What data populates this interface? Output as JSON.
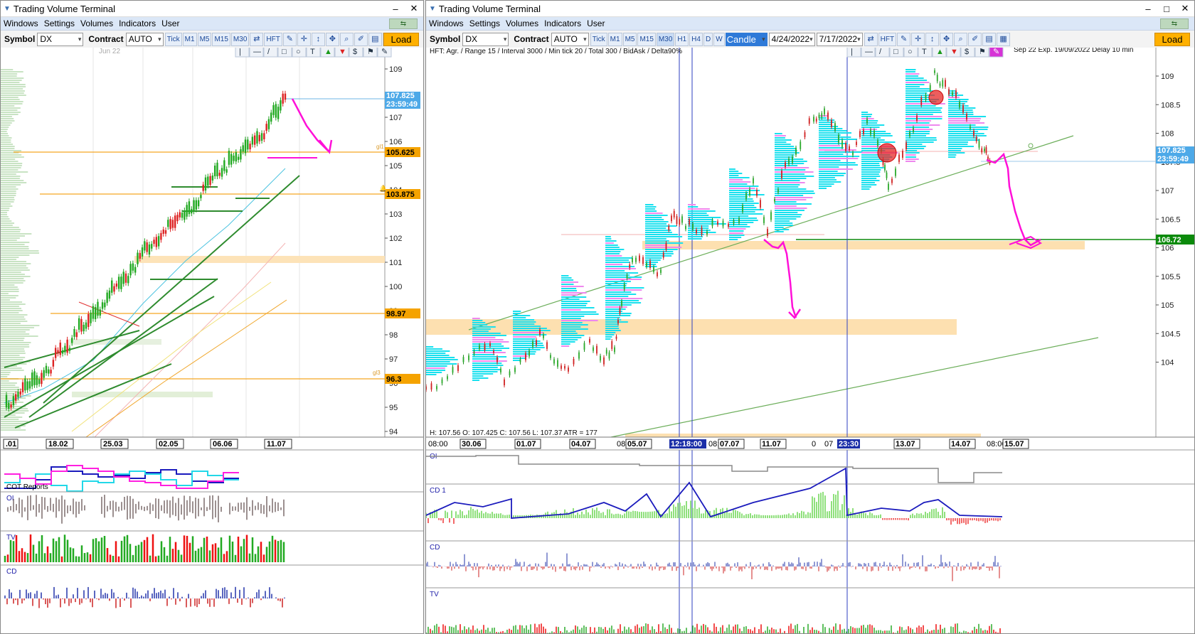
{
  "app": {
    "title": "Trading Volume Terminal"
  },
  "menu": [
    "Windows",
    "Settings",
    "Volumes",
    "Indicators",
    "User"
  ],
  "window_controls": {
    "minimize": "–",
    "maximize": "□",
    "close": "✕"
  },
  "left": {
    "symbol_label": "Symbol",
    "symbol": "DX",
    "contract_label": "Contract",
    "contract": "AUTO",
    "timeframes": [
      "Tick",
      "M1",
      "M5",
      "M15",
      "M30"
    ],
    "hft": "HFT",
    "load": "Load",
    "month_label": "Jun 22",
    "price_ticks": [
      "109",
      "107",
      "106",
      "105",
      "104",
      "103",
      "102",
      "101",
      "100",
      "99",
      "98",
      "97",
      "96",
      "95",
      "94"
    ],
    "price_labels": {
      "last": "107.825",
      "countdown": "23:59:49",
      "l1": "105.625",
      "l2": "103.875",
      "l3": "98.97",
      "l4": "96.3"
    },
    "level_tags": {
      "gl1": "gl1",
      "gl3": "gl3"
    },
    "dates": [
      ".01",
      "18.02",
      "25.03",
      "02.05",
      "06.06",
      "11.07"
    ],
    "panels": {
      "cot": "COT Reports",
      "oi": "OI",
      "tv": "TV",
      "cd": "CD"
    }
  },
  "right": {
    "symbol_label": "Symbol",
    "symbol": "DX",
    "contract_label": "Contract",
    "contract": "AUTO",
    "timeframes": [
      "Tick",
      "M1",
      "M5",
      "M15",
      "M30",
      "H1",
      "H4",
      "D",
      "W"
    ],
    "hft": "HFT",
    "chart_type": "Candle",
    "date_from": "4/24/2022",
    "date_to": "7/17/2022",
    "load": "Load",
    "info_line": "HFT: Agr. / Range 15 / Interval 3000 / Min tick 20 / Total 300 / BidAsk / Delta90%",
    "expiry": "Sep 22 Exp. 19/09/2022 Delay 10 min",
    "price_ticks": [
      "109",
      "108.5",
      "108",
      "107.5",
      "107",
      "106.5",
      "106",
      "105.5",
      "105",
      "104.5",
      "104"
    ],
    "price_labels": {
      "last": "107.825",
      "countdown": "23:59:49",
      "level": "106.72"
    },
    "ohlc": "H: 107.56   O: 107.425   C: 107.56   L: 107.37   ATR = 177",
    "time_labels": [
      "08:00",
      "30.06",
      "01.07",
      "04.07",
      "08",
      "05.07",
      "08:00",
      "07.07",
      "11.07",
      "0",
      "07",
      "0",
      "13.07",
      "14.07",
      "08:00",
      "15.07"
    ],
    "cursor_times": [
      "12:18:00",
      "23:30"
    ],
    "panels": {
      "oi": "OI",
      "cd1": "CD 1",
      "cd": "CD",
      "tv": "TV"
    }
  }
}
